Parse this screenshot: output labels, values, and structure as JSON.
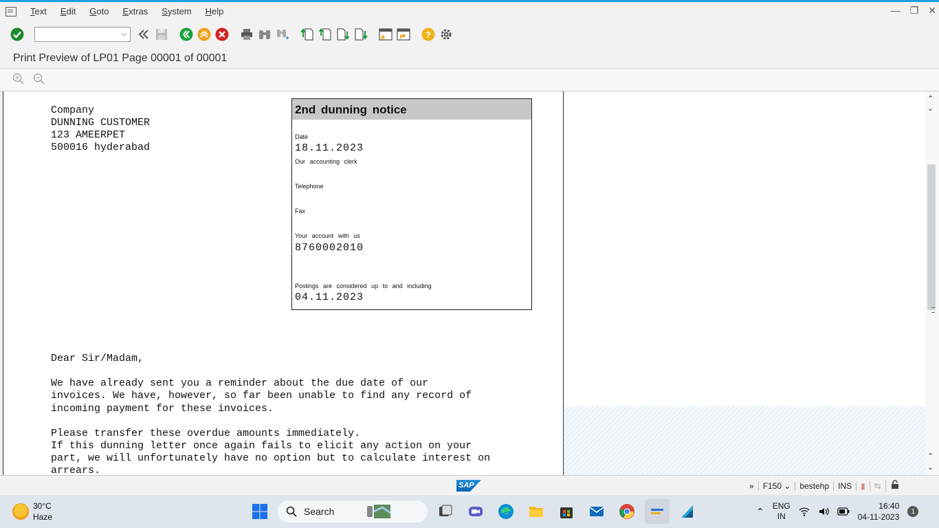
{
  "menu": {
    "items": [
      "Text",
      "Edit",
      "Goto",
      "Extras",
      "System",
      "Help"
    ]
  },
  "toolbar": {
    "command_field_value": ""
  },
  "title": "Print Preview of LP01 Page 00001 of 00001",
  "document": {
    "address_lines": [
      "Company",
      "DUNNING CUSTOMER",
      "123 AMEERPET",
      "500016 hyderabad"
    ],
    "notice": {
      "heading": "2nd dunning notice",
      "date_label": "Date",
      "date_value": "18.11.2023",
      "clerk_label": "Our accounting clerk",
      "telephone_label": "Telephone",
      "fax_label": "Fax",
      "account_label": "Your account with us",
      "account_value": "8760002010",
      "postings_label": "Postings are considered up to and including",
      "postings_value": "04.11.2023"
    },
    "salutation": "Dear Sir/Madam,",
    "paragraph1": [
      "We have already sent you a reminder about the due date of our",
      "invoices. We have, however, so far been unable to find any record of",
      "incoming payment for these invoices."
    ],
    "paragraph2": [
      "Please transfer these overdue amounts immediately.",
      "If this dunning letter once again fails to elicit any action on your",
      "part, we will unfortunately have no option but to calculate interest on",
      "arrears."
    ]
  },
  "status": {
    "sap_logo": "SAP",
    "system": "F150",
    "user": "bestehp",
    "mode": "INS"
  },
  "taskbar": {
    "weather_temp": "30°C",
    "weather_desc": "Haze",
    "search_label": "Search",
    "lang_top": "ENG",
    "lang_bottom": "IN",
    "time": "16:40",
    "date": "04-11-2023",
    "notifications": "1"
  },
  "colors": {
    "accent": "#1ba1e2",
    "ok_green": "#1c8a2b",
    "back_green": "#17a33a",
    "exit_orange": "#f0a31c",
    "cancel_red": "#d42020",
    "help_yellow": "#f1b21b"
  }
}
